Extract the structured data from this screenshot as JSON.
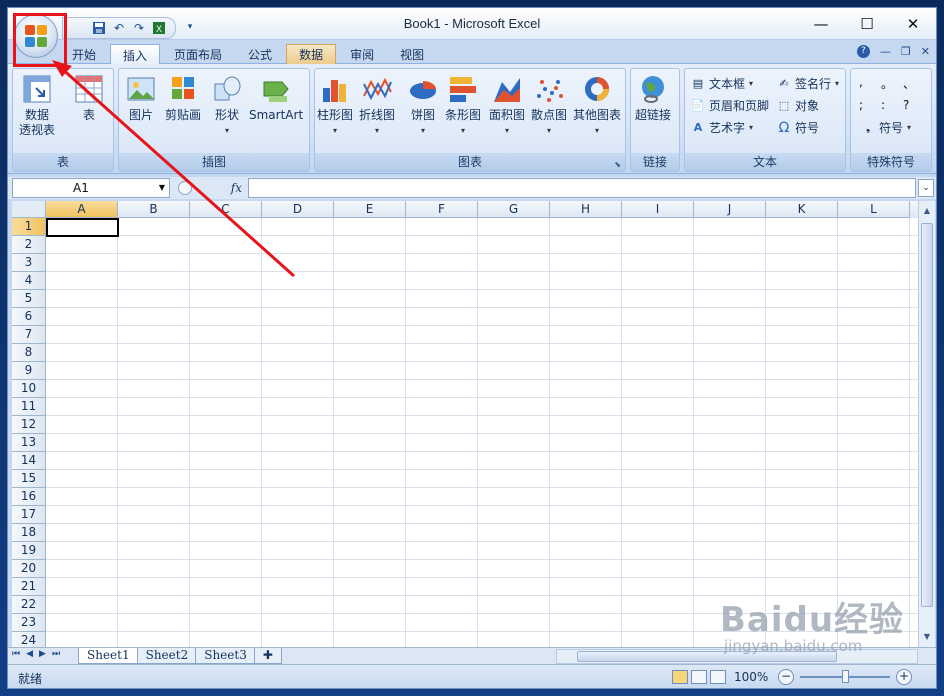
{
  "window": {
    "title": "Book1 - Microsoft Excel",
    "minimize": "—",
    "maximize": "☐",
    "close": "✕"
  },
  "qat": {
    "customize": "▾"
  },
  "tabs": [
    "开始",
    "插入",
    "页面布局",
    "公式",
    "数据",
    "审阅",
    "视图"
  ],
  "active_tab": "插入",
  "ribbon": {
    "groups": {
      "table": "表",
      "illustrations": "插图",
      "charts": "图表",
      "links": "链接",
      "text": "文本",
      "symbols": "特殊符号"
    },
    "table": {
      "pivot_line1": "数据",
      "pivot_line2": "透视表",
      "table": "表"
    },
    "illustrations": {
      "picture": "图片",
      "clipart": "剪贴画",
      "shapes": "形状",
      "smartart": "SmartArt"
    },
    "charts": {
      "column": "柱形图",
      "line": "折线图",
      "pie": "饼图",
      "bar": "条形图",
      "area": "面积图",
      "scatter": "散点图",
      "other": "其他图表"
    },
    "links": {
      "hyperlink": "超链接"
    },
    "text": {
      "textbox": "文本框",
      "header_footer": "页眉和页脚",
      "wordart": "艺术字",
      "signature": "签名行",
      "object": "对象",
      "symbol": "符号"
    },
    "symbols": {
      "grid": [
        ",",
        "。",
        "、",
        ";",
        ":",
        "?"
      ],
      "symbol_btn": "符号"
    }
  },
  "formula_bar": {
    "namebox": "A1",
    "fx": "fx"
  },
  "grid": {
    "columns": [
      "A",
      "B",
      "C",
      "D",
      "E",
      "F",
      "G",
      "H",
      "I",
      "J",
      "K",
      "L"
    ],
    "rows": [
      "1",
      "2",
      "3",
      "4",
      "5",
      "6",
      "7",
      "8",
      "9",
      "10",
      "11",
      "12",
      "13",
      "14",
      "15",
      "16",
      "17",
      "18",
      "19",
      "20",
      "21",
      "22",
      "23",
      "24"
    ],
    "active_cell": "A1"
  },
  "sheets": [
    "Sheet1",
    "Sheet2",
    "Sheet3"
  ],
  "active_sheet": "Sheet1",
  "status": {
    "ready": "就绪",
    "zoom": "100%"
  },
  "watermark": {
    "line1": "Baidu经验",
    "line2": "jingyan.baidu.com"
  },
  "colors": {
    "annotation": "#e8141b",
    "ribbon": "#d4e3f6",
    "selected_header": "#f1c15f"
  }
}
